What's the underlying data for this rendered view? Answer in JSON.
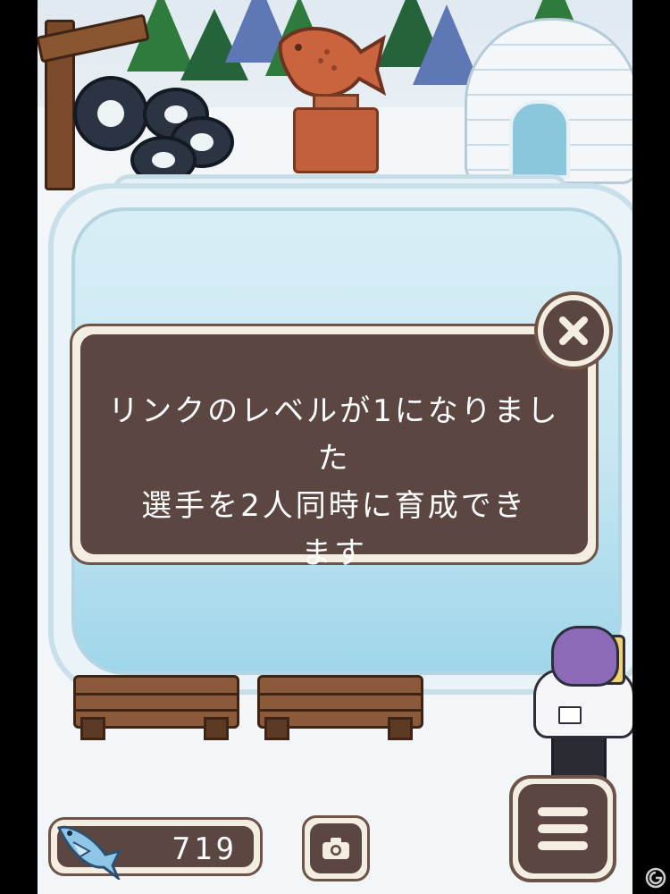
{
  "scene": {
    "name": "ice-rink-hub"
  },
  "dialog": {
    "message_lines": [
      "リンクのレベルが1になりました",
      "選手を2人同時に育成でき",
      "ます"
    ],
    "close_icon": "close-x-icon"
  },
  "hud": {
    "currency_value": "719",
    "currency_icon": "fish-icon",
    "camera_icon": "camera-icon",
    "menu_icon": "hamburger-menu-icon"
  },
  "colors": {
    "panel_bg": "#5b4641",
    "panel_border": "#f4ede2",
    "ice": "#c9e7f2"
  }
}
